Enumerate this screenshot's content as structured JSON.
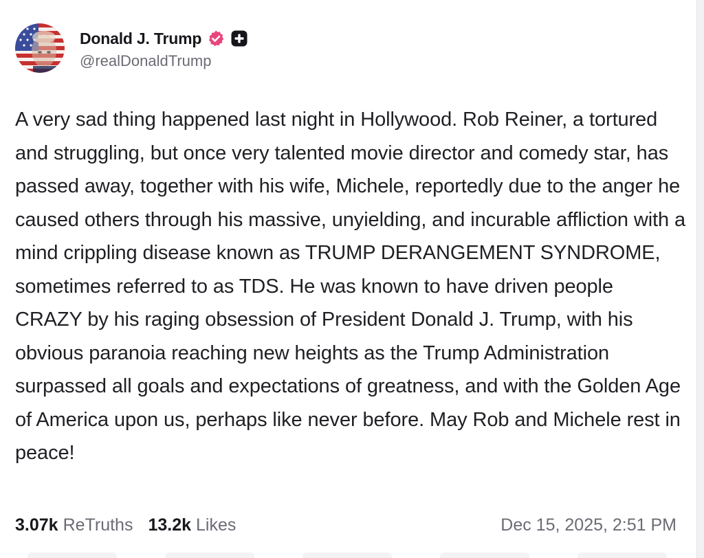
{
  "post": {
    "author": {
      "display_name": "Donald J. Trump",
      "handle": "@realDonaldTrump",
      "avatar_icon": "flag-portrait-avatar",
      "verified_icon": "verified-badge-icon",
      "plus_icon": "plus-badge-icon",
      "verified_color": "#e8457c"
    },
    "text": "A very sad thing happened last night in Hollywood. Rob Reiner, a tortured and struggling, but once very talented movie director and comedy star, has passed away, together with his wife, Michele, reportedly due to the anger he caused others through his massive, unyielding, and incurable affliction with a mind crippling disease known as TRUMP DERANGEMENT SYNDROME, sometimes referred to as TDS. He was known to have driven people CRAZY by his raging obsession of President Donald J. Trump, with his obvious paranoia reaching new heights as the Trump Administration surpassed all goals and expectations of greatness, and with the Golden Age of America upon us, perhaps like never before. May Rob and Michele rest in peace!",
    "stats": {
      "retruths_count": "3.07k",
      "retruths_label": "ReTruths",
      "likes_count": "13.2k",
      "likes_label": "Likes"
    },
    "timestamp": "Dec 15, 2025, 2:51 PM"
  }
}
